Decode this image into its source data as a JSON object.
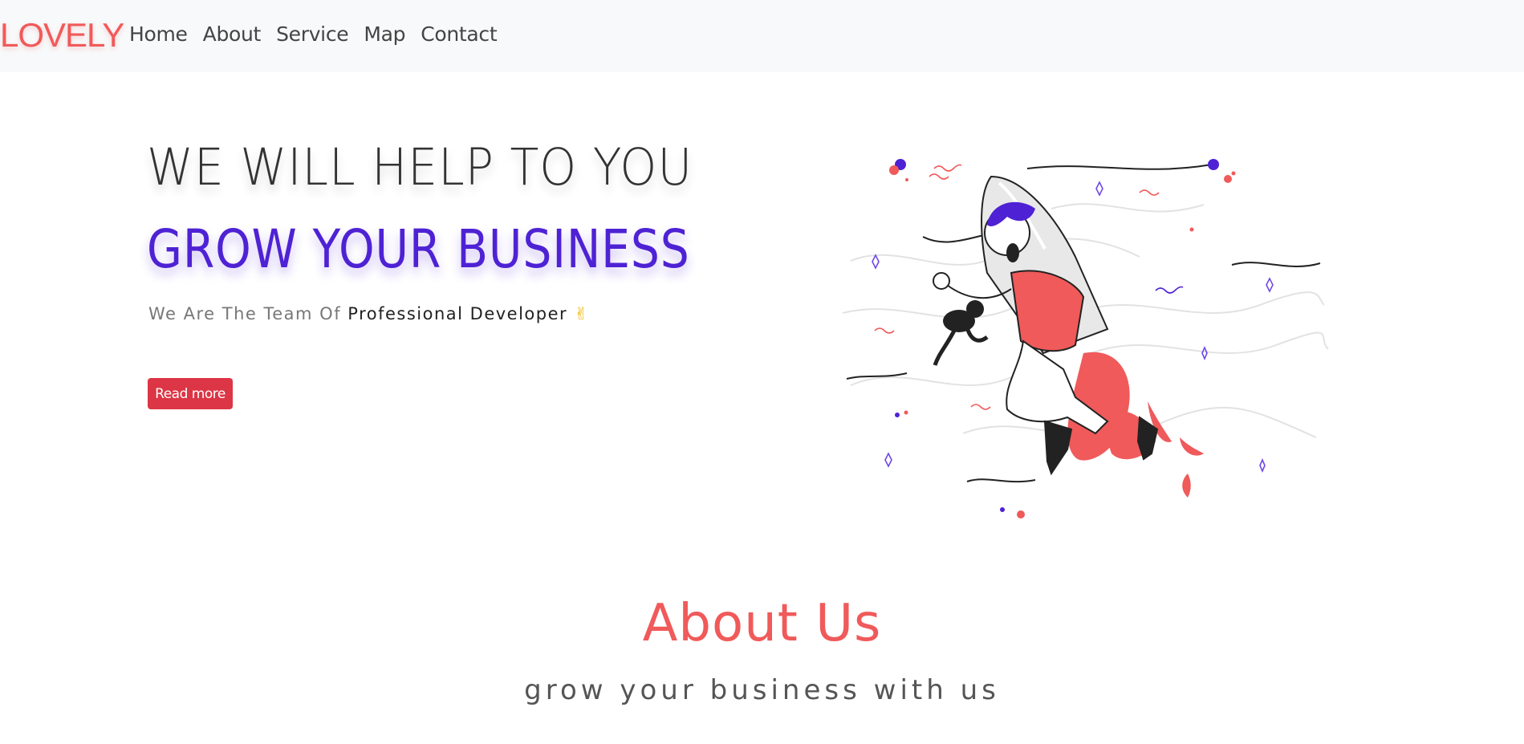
{
  "navbar": {
    "brand": "LOVELY",
    "links": [
      "Home",
      "About",
      "Service",
      "Map",
      "Contact"
    ]
  },
  "hero": {
    "line1": "WE WILL HELP TO YOU",
    "line2": "GROW YOUR BUSINESS",
    "subtitle_prefix": "We Are The Team Of ",
    "subtitle_strong": "Professional Developer",
    "subtitle_emoji": "✌",
    "button_label": "Read more",
    "illustration_icon": "rocket-man-illustration"
  },
  "about": {
    "title": "About Us",
    "subtitle": "grow your business with us"
  },
  "colors": {
    "brand": "#f05a5a",
    "accent_purple": "#4e22d4",
    "button": "#dc3545",
    "navbar_bg": "#f8f9fa"
  }
}
